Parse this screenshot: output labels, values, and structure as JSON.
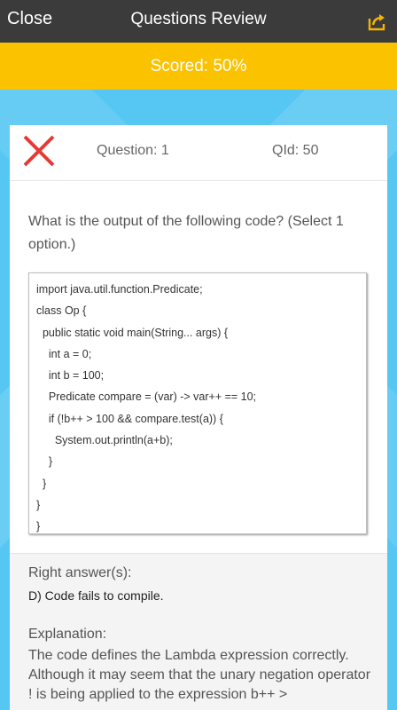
{
  "topbar": {
    "close_label": "Close",
    "title": "Questions Review",
    "share_icon": "share-icon"
  },
  "score": {
    "text": "Scored: 50%"
  },
  "card": {
    "status_icon": "wrong-answer-x-icon",
    "status_color": "#e53935",
    "question_number": "Question: 1",
    "question_id": "QId: 50",
    "question_text": "What is the output of the following code? (Select 1 option.)",
    "code_lines": [
      "import java.util.function.Predicate;",
      "class Op {",
      "  public static void main(String... args) {",
      "    int a = 0;",
      "    int b = 100;",
      "    Predicate compare = (var) -> var++ == 10;",
      "    if (!b++ > 100 && compare.test(a)) {",
      "      System.out.println(a+b);",
      "    }",
      "  }",
      "}",
      "}"
    ],
    "right_answer_label": "Right answer(s):",
    "right_answer": "D) Code fails to compile.",
    "explanation_label": "Explanation:",
    "explanation_text": "The code defines the Lambda expression correctly. Although it may seem that the unary negation operator ! is being applied to the expression b++ >"
  },
  "colors": {
    "topbar": "#3b3b3b",
    "scorebar": "#fbc200",
    "background": "#56c6f3",
    "share_icon": "#f5b400"
  }
}
